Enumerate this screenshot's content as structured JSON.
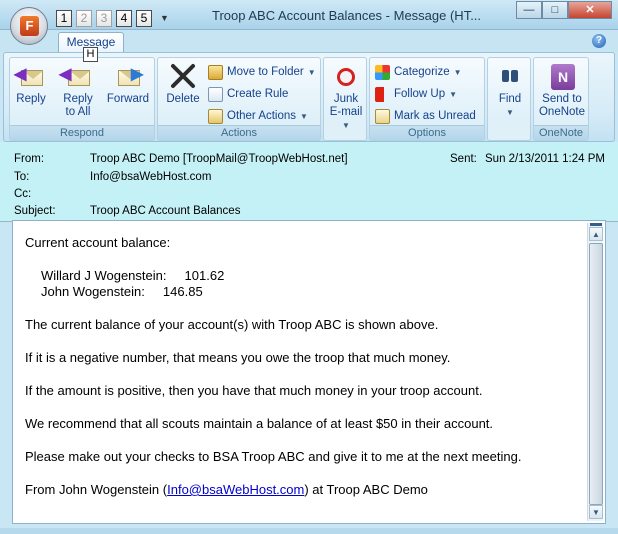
{
  "window": {
    "title": "Troop ABC Account Balances  -  Message (HT...",
    "controls": {
      "minimize": "—",
      "maximize": "□",
      "close": "✕"
    }
  },
  "office_button": {
    "letter": "F"
  },
  "quick_access": {
    "keytips": [
      "1",
      "2",
      "3",
      "4",
      "5"
    ],
    "customize": "▼"
  },
  "tabs": [
    {
      "label": "Message",
      "keytip": "H",
      "active": true
    }
  ],
  "help": "?",
  "ribbon": {
    "respond": {
      "label": "Respond",
      "reply": "Reply",
      "reply_all_line1": "Reply",
      "reply_all_line2": "to All",
      "forward": "Forward"
    },
    "actions": {
      "label": "Actions",
      "delete": "Delete",
      "move_to_folder": "Move to Folder",
      "create_rule": "Create Rule",
      "other_actions": "Other Actions"
    },
    "junk": {
      "line1": "Junk",
      "line2": "E-mail"
    },
    "options": {
      "label": "Options",
      "categorize": "Categorize",
      "follow_up": "Follow Up",
      "mark_as_unread": "Mark as Unread"
    },
    "find": {
      "label": "Find"
    },
    "onenote": {
      "label": "OneNote",
      "line1": "Send to",
      "line2": "OneNote"
    }
  },
  "header": {
    "from_label": "From:",
    "from_value": "Troop ABC Demo [TroopMail@TroopWebHost.net]",
    "sent_label": "Sent:",
    "sent_value": "Sun 2/13/2011 1:24 PM",
    "to_label": "To:",
    "to_value": "Info@bsaWebHost.com",
    "cc_label": "Cc:",
    "cc_value": "",
    "subject_label": "Subject:",
    "subject_value": "Troop ABC Account Balances"
  },
  "body": {
    "intro": "Current account balance:",
    "accounts": [
      {
        "name": "Willard J Wogenstein:",
        "balance": "101.62"
      },
      {
        "name": "John Wogenstein:",
        "balance": "146.85"
      }
    ],
    "p1": "The current balance of your account(s) with Troop ABC is shown above.",
    "p2": "If it is a negative number, that means you owe the troop that much money.",
    "p3": "If the amount is positive, then you have that much money in your troop account.",
    "p4": "We recommend that all scouts maintain a balance of at least $50 in their account.",
    "p5": "Please make out your checks to BSA Troop ABC and give it to me at the next meeting.",
    "sign_prefix": "From John Wogenstein (",
    "sign_link": "Info@bsaWebHost.com",
    "sign_suffix": ") at Troop ABC Demo"
  },
  "colors": {
    "header_bg": "#c4f1f5",
    "link": "#0000cc",
    "ribbon_text": "#15428b"
  }
}
